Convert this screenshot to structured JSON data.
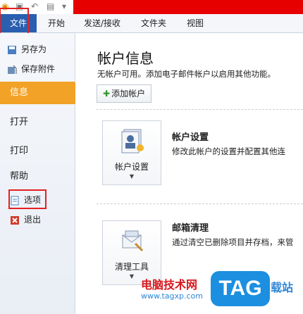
{
  "ribbon": {
    "file_tab": "文件",
    "tabs": [
      "开始",
      "发送/接收",
      "文件夹",
      "视图"
    ]
  },
  "sidebar": {
    "save_as": "另存为",
    "save_attachments": "保存附件",
    "info": "信息",
    "open": "打开",
    "print": "打印",
    "help": "帮助",
    "options": "选项",
    "exit": "退出"
  },
  "main": {
    "title": "帐户信息",
    "description": "无帐户可用。添加电子邮件帐户以启用其他功能。",
    "add_account": "添加帐户",
    "account_settings": {
      "button_label": "帐户设置",
      "title": "帐户设置",
      "description": "修改此帐户的设置并配置其他连"
    },
    "mailbox_cleanup": {
      "button_label": "清理工具",
      "title": "邮箱清理",
      "description": "通过清空已删除项目并存档，来管"
    }
  },
  "watermark": {
    "line1": "电脑技术网",
    "line2": "www.tagxp.com",
    "badge": "TAG",
    "suffix": "载站"
  },
  "colors": {
    "file_tab": "#2a5fb0",
    "active_item": "#f2a227",
    "highlight": "#e52020",
    "titlebar": "#e60000"
  }
}
